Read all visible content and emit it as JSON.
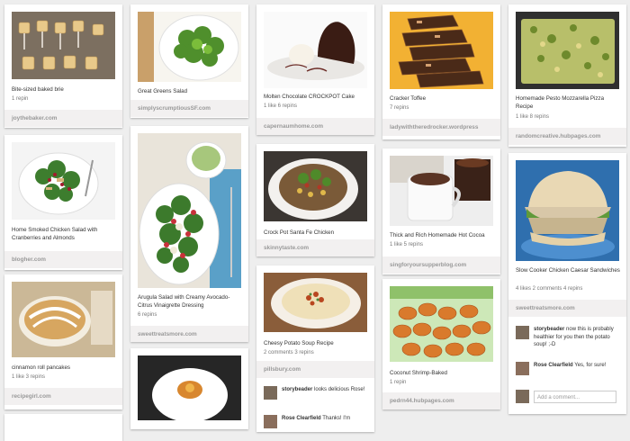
{
  "pins": {
    "c1p1": {
      "title": "Bite-sized baked brie",
      "stats": "1 repin",
      "source": "joythebaker.com"
    },
    "c1p2": {
      "title": "Home Smoked Chicken Salad with Cranberries and Almonds",
      "stats": "",
      "source": "blogher.com"
    },
    "c1p3": {
      "title": "cinnamon roll pancakes",
      "stats": "1 like  3 repins",
      "source": "recipegirl.com"
    },
    "c2p1": {
      "title": "Great Greens Salad",
      "stats": "",
      "source": "simplyscrumptiousSF.com"
    },
    "c2p2": {
      "title": "Arugula Salad with Creamy Avocado-Citrus Vinaigrette Dressing",
      "stats": "6 repins",
      "source": "sweettreatsmore.com"
    },
    "c3p1": {
      "title": "Molten Chocolate CROCKPOT Cake",
      "stats": "1 like  6 repins",
      "source": "capernaumhome.com"
    },
    "c3p2": {
      "title": "Crock Pot Santa Fe Chicken",
      "stats": "",
      "source": "skinnytaste.com"
    },
    "c3p3": {
      "title": "Cheesy Potato Soup Recipe",
      "stats": "2 comments  3 repins",
      "source": "pillsbury.com"
    },
    "c4p1": {
      "title": "Cracker Toffee",
      "stats": "7 repins",
      "source": "ladywiththeredrocker.wordpress"
    },
    "c4p2": {
      "title": "Thick and Rich Homemade Hot Cocoa",
      "stats": "1 like  5 repins",
      "source": "singforyoursupperblog.com"
    },
    "c4p3": {
      "title": "Coconut Shrimp-Baked",
      "stats": "1 repin",
      "source": "pedrn44.hubpages.com"
    },
    "c5p1": {
      "title": "Homemade Pesto Mozzarella Pizza Recipe",
      "stats": "1 like  8 repins",
      "source": "randomcreative.hubpages.com"
    },
    "c5p2": {
      "title": "Slow Cooker Chicken Caesar Sandwiches",
      "stats": "4 likes  2 comments  4 repins",
      "source": "sweettreatsmore.com"
    }
  },
  "comments": {
    "soup1": {
      "user": "storybeader",
      "text": " looks delicious Rose!"
    },
    "soup2": {
      "user": "Rose Clearfield",
      "text": " Thanks! I'm"
    },
    "sand1": {
      "user": "storybeader",
      "text": " now this is probably healthier for you then the potato soup! ;-D"
    },
    "sand2": {
      "user": "Rose Clearfield",
      "text": " Yes, for sure!"
    }
  },
  "add_comment_placeholder": "Add a comment...",
  "colors": {
    "background": "#eeeeee",
    "source_bar": "#f2f0f0",
    "source_text": "#999999"
  }
}
